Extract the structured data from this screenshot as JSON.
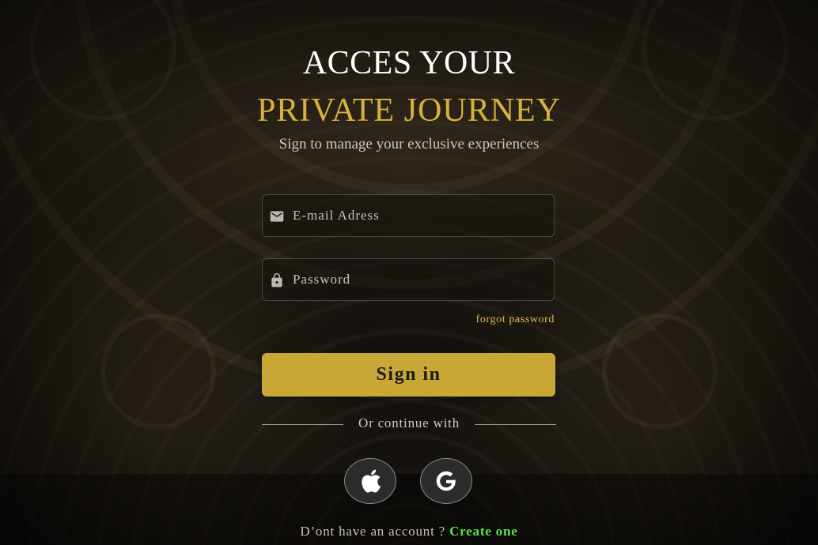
{
  "heading": {
    "line1": "ACCES YOUR",
    "line2": "PRIVATE JOURNEY",
    "subtitle": "Sign to manage your exclusive experiences"
  },
  "form": {
    "email": {
      "placeholder": "E-mail Adress",
      "value": "",
      "icon": "mail-icon"
    },
    "password": {
      "placeholder": "Password",
      "value": "",
      "icon": "lock-icon"
    },
    "forgot_label": "forgot password",
    "signin_label": "Sign in"
  },
  "social": {
    "divider_label": "Or continue with",
    "providers": [
      {
        "name": "apple",
        "icon": "apple-icon"
      },
      {
        "name": "google",
        "icon": "google-icon"
      }
    ]
  },
  "footer": {
    "prompt": "D’ont have an account ?",
    "create_label": "Create one"
  },
  "colors": {
    "accent_gold": "#d6b23c",
    "button_gold": "#c9a737",
    "link_green": "#5ee04a"
  }
}
